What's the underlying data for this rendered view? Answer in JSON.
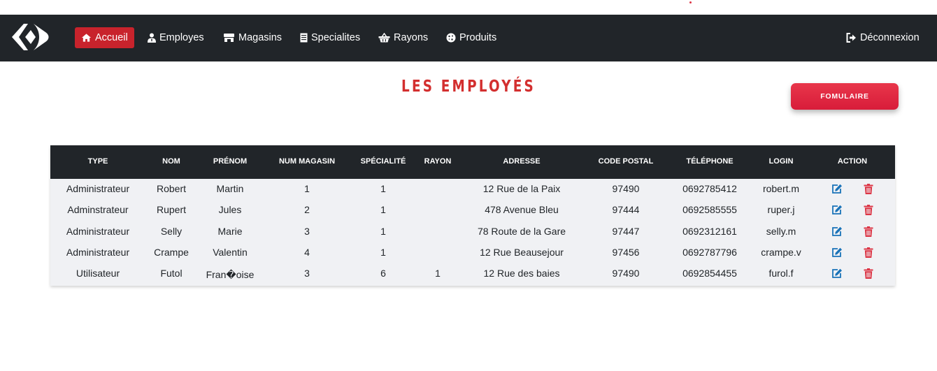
{
  "nav": {
    "items": [
      {
        "label": "Accueil",
        "icon": "home-icon",
        "active": true
      },
      {
        "label": "Employes",
        "icon": "user-tie-icon",
        "active": false
      },
      {
        "label": "Magasins",
        "icon": "store-icon",
        "active": false
      },
      {
        "label": "Specialites",
        "icon": "document-icon",
        "active": false
      },
      {
        "label": "Rayons",
        "icon": "basket-icon",
        "active": false
      },
      {
        "label": "Produits",
        "icon": "cookie-icon",
        "active": false
      }
    ],
    "logout": {
      "label": "Déconnexion",
      "icon": "sign-out-icon"
    }
  },
  "page": {
    "title": "LES EMPLOYÉS",
    "form_button": "FOMULAIRE"
  },
  "table": {
    "headers": [
      "TYPE",
      "NOM",
      "PRÉNOM",
      "NUM MAGASIN",
      "SPÉCIALITÉ",
      "RAYON",
      "ADRESSE",
      "CODE POSTAL",
      "TÉLÉPHONE",
      "LOGIN",
      "ACTION"
    ],
    "rows": [
      [
        "Administrateur",
        "Robert",
        "Martin",
        "1",
        "1",
        "",
        "12 Rue de la Paix",
        "97490",
        "0692785412",
        "robert.m"
      ],
      [
        "Adminstrateur",
        "Rupert",
        "Jules",
        "2",
        "1",
        "",
        "478 Avenue Bleu",
        "97444",
        "0692585555",
        "ruper.j"
      ],
      [
        "Administrateur",
        "Selly",
        "Marie",
        "3",
        "1",
        "",
        "78 Route de la Gare",
        "97447",
        "0692312161",
        "selly.m"
      ],
      [
        "Administrateur",
        "Crampe",
        "Valentin",
        "4",
        "1",
        "",
        "12 Rue Beausejour",
        "97456",
        "0692787796",
        "crampe.v"
      ],
      [
        "Utilisateur",
        "Futol",
        "Fran�oise",
        "3",
        "6",
        "1",
        "12 Rue des baies",
        "97490",
        "0692854455",
        "furol.f"
      ]
    ],
    "row_actions": [
      {
        "icon": "edit-icon",
        "color": "#1a73b8"
      },
      {
        "icon": "trash-icon",
        "color": "#dc3545"
      }
    ]
  },
  "colors": {
    "navbar": "#212529",
    "accent": "#c8232c",
    "title": "#d32f2f",
    "edit": "#1a73b8",
    "delete": "#dc3545"
  }
}
